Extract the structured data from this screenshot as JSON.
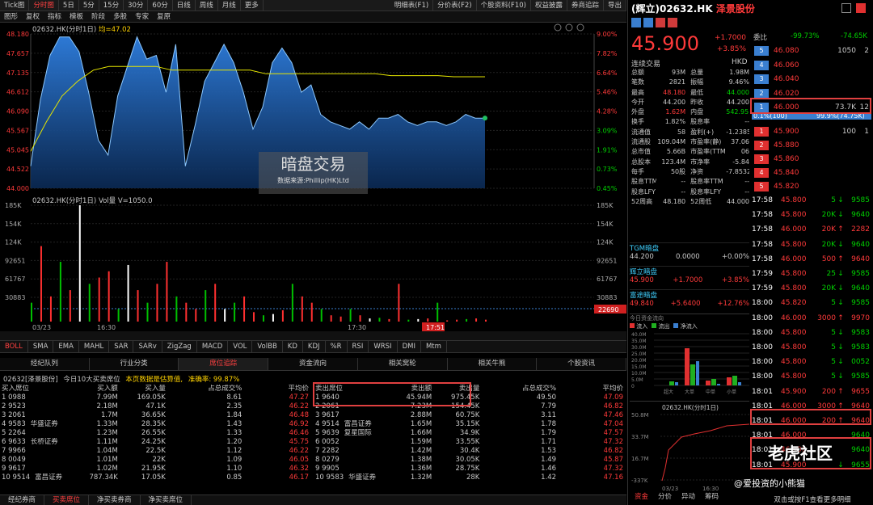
{
  "toolbar": {
    "items": [
      "Tick图",
      "分时图",
      "5日",
      "5分",
      "15分",
      "30分",
      "60分",
      "日线",
      "周线",
      "月线",
      "更多"
    ],
    "right": [
      "明细表(F1)",
      "分价表(F2)",
      "个股资料(F10)",
      "权益披露",
      "券商追踪",
      "导出"
    ]
  },
  "toolbar2": [
    "图形",
    "复权",
    "指标",
    "模板",
    "阶段",
    "多股",
    "专家",
    "复原"
  ],
  "chart1": {
    "title": "02632.HK(分时1日)",
    "avg_label": "均=47.02",
    "yticks": [
      "48.180",
      "47.657",
      "47.135",
      "46.612",
      "46.090",
      "45.567",
      "45.045",
      "44.522",
      "44.000"
    ],
    "pticks": [
      "9.00%",
      "7.82%",
      "6.64%",
      "5.46%",
      "4.28%",
      "3.09%",
      "1.91%",
      "0.73%",
      "0.45%"
    ],
    "watermark": "暗盘交易",
    "watermark_sub": "数据来源:Phillip(HK)Ltd"
  },
  "chart2": {
    "title": "02632.HK(分时1日) Vol量 V=1050.0",
    "yticks": [
      "185K",
      "154K",
      "124K",
      "92651",
      "61767",
      "30883"
    ],
    "x_labels": [
      "03/23",
      "16:30",
      "17:30"
    ],
    "cursor_time": "17:51",
    "cursor_val": "22690"
  },
  "indicators": [
    "BOLL",
    "SMA",
    "EMA",
    "MAHL",
    "SAR",
    "SARv",
    "ZigZag",
    "MACD",
    "VOL",
    "VolBB",
    "KD",
    "KDJ",
    "%R",
    "RSI",
    "WRSI",
    "DMI",
    "Mtm"
  ],
  "tabs3": [
    "经纪队列",
    "行业分类",
    "席位追踪",
    "资金流向",
    "相关窝轮",
    "相关牛熊",
    "个股资讯"
  ],
  "note": {
    "code": "02632[泽景股份]",
    "text": "今日10大买卖席位",
    "warn": "本页数据是估算值,",
    "ratio": "准确率: 99.87%"
  },
  "buy_headers": [
    "买入席位",
    "买入额",
    "买入量",
    "占总成交%",
    "平均价"
  ],
  "buy": [
    [
      "1 0988",
      "",
      "7.99M",
      "169.05K",
      "8.61",
      "47.27"
    ],
    [
      "2 9523",
      "",
      "2.18M",
      "47.1K",
      "2.35",
      "46.22"
    ],
    [
      "3 2061",
      "",
      "1.7M",
      "36.65K",
      "1.84",
      "46.48"
    ],
    [
      "4 9583",
      "华盛证券",
      "1.33M",
      "28.35K",
      "1.43",
      "46.92"
    ],
    [
      "5 2264",
      "",
      "1.23M",
      "26.55K",
      "1.33",
      "46.46"
    ],
    [
      "6 9633",
      "长桥证券",
      "1.11M",
      "24.25K",
      "1.20",
      "45.75"
    ],
    [
      "7 9966",
      "",
      "1.04M",
      "22.5K",
      "1.12",
      "46.22"
    ],
    [
      "8 0049",
      "",
      "1.01M",
      "22K",
      "1.09",
      "46.05"
    ],
    [
      "9 9617",
      "",
      "1.02M",
      "21.95K",
      "1.10",
      "46.32"
    ],
    [
      "10 9514",
      "富昌证券",
      "787.34K",
      "17.05K",
      "0.85",
      "46.17"
    ]
  ],
  "sell_headers": [
    "卖出席位",
    "卖出额",
    "卖出量",
    "占总成交%",
    "平均价"
  ],
  "sell": [
    [
      "1 9640",
      "",
      "45.94M",
      "975.45K",
      "49.50",
      "47.09"
    ],
    [
      "2 2061",
      "",
      "7.23M",
      "154.45K",
      "7.79",
      "46.82"
    ],
    [
      "3 9617",
      "",
      "2.88M",
      "60.75K",
      "3.11",
      "47.46"
    ],
    [
      "4 9514",
      "富昌证券",
      "1.65M",
      "35.15K",
      "1.78",
      "47.04"
    ],
    [
      "5 9639",
      "复星国际",
      "1.66M",
      "34.9K",
      "1.79",
      "47.57"
    ],
    [
      "6 0052",
      "",
      "1.59M",
      "33.55K",
      "1.71",
      "47.32"
    ],
    [
      "7 2282",
      "",
      "1.42M",
      "30.4K",
      "1.53",
      "46.82"
    ],
    [
      "8 0279",
      "",
      "1.38M",
      "30.05K",
      "1.49",
      "45.87"
    ],
    [
      "9 9905",
      "",
      "1.36M",
      "28.75K",
      "1.46",
      "47.32"
    ],
    [
      "10 9583",
      "华盛证券",
      "1.32M",
      "28K",
      "1.42",
      "47.16"
    ]
  ],
  "bottom_tabs": [
    "经纪券商",
    "买卖席位",
    "净买卖券商",
    "净买卖席位"
  ],
  "stock": {
    "name": "(辉立)02632.HK",
    "cname": "泽景股份",
    "price": "45.900",
    "change": "+1.7000",
    "pct": "+3.85%",
    "desc": "连续交易",
    "ccy": "HKD"
  },
  "stats": [
    [
      "总额",
      "93M",
      "总量",
      "1.98M"
    ],
    [
      "笔数",
      "2821",
      "振幅",
      "9.46%"
    ],
    [
      "最高",
      "48.180",
      "最低",
      "44.000"
    ],
    [
      "今开",
      "44.200",
      "昨收",
      "44.200"
    ],
    [
      "外盘",
      "1.62M",
      "内盘",
      "542.95K"
    ],
    [
      "换手",
      "1.82%",
      "股息率",
      "--"
    ],
    [
      "流通值",
      "58",
      "盈利(+)",
      "-1.2385"
    ],
    [
      "流通股",
      "109.04M",
      "市盈率(静)",
      "37.06"
    ],
    [
      "总市值",
      "5.66B",
      "市盈率(TTM)",
      "06"
    ],
    [
      "总股本",
      "123.4M",
      "市净率",
      "-5.84"
    ],
    [
      "每手",
      "50股",
      "净资",
      "-7.8532"
    ],
    [
      "股息TTM",
      "--",
      "股息率TTM",
      "--"
    ],
    [
      "股息LFY",
      "--",
      "股息率LFY",
      "--"
    ],
    [
      "52周高",
      "48.180",
      "52周低",
      "44.000"
    ]
  ],
  "dark": [
    {
      "title": "TGM暗盘",
      "p": "44.200",
      "c": "0.0000",
      "pct": "+0.00%"
    },
    {
      "title": "辉立暗盘",
      "p": "45.900",
      "c": "+1.7000",
      "pct": "+3.85%"
    },
    {
      "title": "富途暗盘",
      "p": "49.840",
      "c": "+5.6400",
      "pct": "+12.76%"
    }
  ],
  "flow": {
    "title": "今日资金流向",
    "legend": [
      "流入",
      "流出",
      "净流入"
    ],
    "yticks": [
      "40.0M",
      "35.0M",
      "30.0M",
      "25.0M",
      "20.0M",
      "15.0M",
      "10.0M",
      "5.0M",
      "0"
    ],
    "cats": [
      "超大",
      "大单",
      "中单",
      "小单"
    ]
  },
  "mini": {
    "title": "02632.HK(分时1日)",
    "yticks": [
      "50.8M",
      "33.7M",
      "16.7M",
      "-337K"
    ],
    "x": [
      "03/23",
      "16:30"
    ]
  },
  "right_tabs": [
    "资金",
    "分价",
    "异动",
    "筹码"
  ],
  "order": {
    "label": "委比",
    "v1": "-99.73%",
    "label2": "委差",
    "v2": "-74.65K"
  },
  "asks": [
    [
      "5",
      "46.080",
      "1050",
      "2"
    ],
    [
      "4",
      "46.060",
      "",
      ""
    ],
    [
      "3",
      "46.040",
      "",
      ""
    ],
    [
      "2",
      "46.020",
      "",
      ""
    ],
    [
      "1",
      "46.000",
      "73.7K",
      "12"
    ]
  ],
  "mid": {
    "a": "0.1%(100)",
    "b": "99.9%(74.75K)"
  },
  "bids": [
    [
      "1",
      "45.900",
      "100",
      "1"
    ],
    [
      "2",
      "45.880",
      "",
      ""
    ],
    [
      "3",
      "45.860",
      "",
      ""
    ],
    [
      "4",
      "45.840",
      "",
      ""
    ],
    [
      "5",
      "45.820",
      "",
      ""
    ]
  ],
  "ticks": [
    [
      "17:58",
      "45.800",
      "5",
      "↓",
      "9585"
    ],
    [
      "17:58",
      "45.800",
      "20K",
      "↓",
      "9640"
    ],
    [
      "17:58",
      "46.000",
      "20K",
      "↑",
      "2282"
    ],
    [
      "17:58",
      "45.800",
      "20K",
      "↓",
      "9640"
    ],
    [
      "17:58",
      "46.000",
      "500",
      "↑",
      "9640"
    ],
    [
      "17:59",
      "45.800",
      "25",
      "↓",
      "9585"
    ],
    [
      "17:59",
      "45.800",
      "20K",
      "↓",
      "9640"
    ],
    [
      "18:00",
      "45.820",
      "5",
      "↓",
      "9585"
    ],
    [
      "18:00",
      "46.000",
      "3000",
      "↑",
      "9970"
    ],
    [
      "18:00",
      "45.800",
      "5",
      "↓",
      "9583"
    ],
    [
      "18:00",
      "45.800",
      "5",
      "↓",
      "9583"
    ],
    [
      "18:00",
      "45.800",
      "5",
      "↓",
      "0052"
    ],
    [
      "18:00",
      "45.800",
      "5",
      "↓",
      "9585"
    ],
    [
      "18:01",
      "45.900",
      "200",
      "↑",
      "9655"
    ],
    [
      "18:01",
      "46.000",
      "3000",
      "↑",
      "9640"
    ],
    [
      "18:01",
      "46.000",
      "200",
      "↑",
      "9640"
    ],
    [
      "18:01",
      "46.000",
      "",
      "",
      "9640"
    ],
    [
      "18:01",
      "46.000",
      "",
      "",
      "9640"
    ],
    [
      "18:01",
      "45.900",
      "",
      "↓",
      "9655"
    ]
  ],
  "footer": "双击或按F1查看更多明细",
  "brand": "老虎社区",
  "handle": "@爱投资的小熊猫",
  "chart_data": {
    "type": "area",
    "title": "02632.HK(分时1日)",
    "ylim": [
      44.0,
      48.18
    ],
    "series": [
      {
        "name": "price",
        "values": [
          44.6,
          46.4,
          47.6,
          48.1,
          48.1,
          47.7,
          46.6,
          45.3,
          44.9,
          46.5,
          47.3,
          48.1,
          47.5,
          47.6,
          46.6,
          47.9,
          44.6,
          45.7,
          46.9,
          47.4,
          47.9,
          47.4,
          46.6,
          45.6,
          46.2,
          47.4,
          47.8,
          47.4,
          46.6,
          46.8,
          46.0,
          45.8,
          45.7,
          45.6,
          45.8,
          45.6,
          45.9,
          45.9,
          46.0,
          45.8,
          45.7,
          45.8,
          45.8,
          45.7,
          45.8,
          46.0,
          45.9,
          45.9
        ]
      },
      {
        "name": "avg",
        "values": [
          45.0,
          45.8,
          46.5,
          46.9,
          47.2,
          47.3,
          47.3,
          47.3,
          47.3,
          47.2,
          47.2,
          47.2,
          47.2,
          47.2,
          47.2,
          47.1,
          47.1,
          47.1,
          47.1,
          47.1,
          47.1,
          47.1,
          47.1,
          47.05,
          47.05,
          47.05,
          47.05,
          47.02,
          47.02,
          47.02
        ]
      }
    ],
    "volume": [
      30,
      120,
      40,
      95,
      50,
      185,
      60,
      70,
      80,
      20,
      90,
      50,
      30,
      60,
      95,
      40,
      30,
      20,
      50,
      60,
      20,
      30,
      40,
      15,
      10,
      12,
      18,
      60,
      40,
      30,
      20,
      10,
      8,
      20,
      10,
      5,
      6,
      4,
      60,
      3,
      4,
      5,
      30,
      2,
      3,
      4,
      5,
      3
    ]
  }
}
